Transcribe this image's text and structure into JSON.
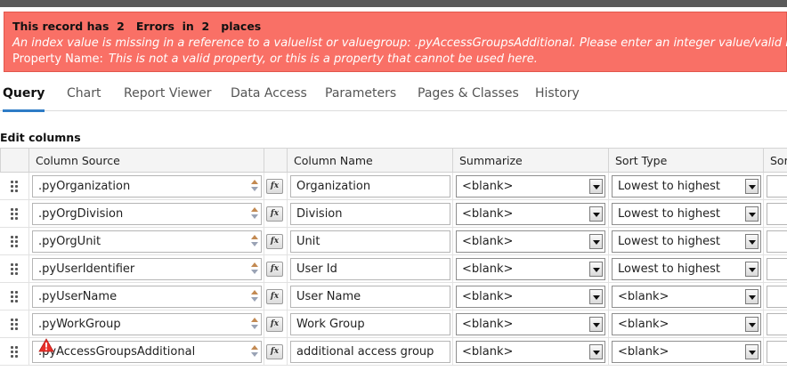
{
  "error": {
    "title": "This record has  2   Errors  in  2   places",
    "message": "An index value is missing in a reference to a valuelist or valuegroup: .pyAccessGroupsAdditional. Please enter an integer value/valid name.",
    "property_label": "Property Name:",
    "property_message": "This is not a valid property, or this is a property that cannot be used here."
  },
  "tabs": [
    {
      "label": "Query",
      "active": true
    },
    {
      "label": "Chart"
    },
    {
      "label": "Report Viewer"
    },
    {
      "label": "Data Access"
    },
    {
      "label": "Parameters"
    },
    {
      "label": "Pages & Classes"
    },
    {
      "label": "History"
    }
  ],
  "section_title": "Edit columns",
  "columns": {
    "source": "Column Source",
    "name": "Column Name",
    "summarize": "Summarize",
    "sort_type": "Sort Type",
    "sort_order": "Sor"
  },
  "fx_label": "fx",
  "rows": [
    {
      "source": ".pyOrganization",
      "name": "Organization",
      "summarize": "<blank>",
      "sort_type": "Lowest to highest"
    },
    {
      "source": ".pyOrgDivision",
      "name": "Division",
      "summarize": "<blank>",
      "sort_type": "Lowest to highest"
    },
    {
      "source": ".pyOrgUnit",
      "name": "Unit",
      "summarize": "<blank>",
      "sort_type": "Lowest to highest"
    },
    {
      "source": ".pyUserIdentifier",
      "name": "User Id",
      "summarize": "<blank>",
      "sort_type": "Lowest to highest"
    },
    {
      "source": ".pyUserName",
      "name": "User Name",
      "summarize": "<blank>",
      "sort_type": "<blank>"
    },
    {
      "source": ".pyWorkGroup",
      "name": "Work Group",
      "summarize": "<blank>",
      "sort_type": "<blank>"
    },
    {
      "source": ".pyAccessGroupsAdditional",
      "name": "additional access group",
      "summarize": "<blank>",
      "sort_type": "<blank>",
      "has_error": true
    }
  ],
  "colors": {
    "error_bg": "#f97066",
    "active_tab_underline": "#2e7cc6",
    "warning_icon": "#e8302a"
  }
}
